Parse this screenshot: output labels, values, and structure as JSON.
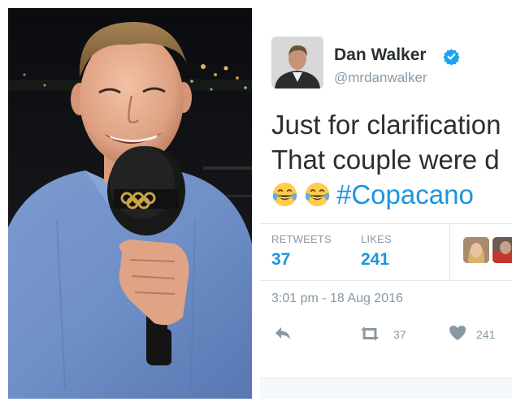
{
  "tweet": {
    "display_name": "Dan Walker",
    "username": "@mrdanwalker",
    "text_line1": "Just for clarification",
    "text_line2": "That couple were d",
    "hashtag": "#Copacano",
    "stats": {
      "retweets_label": "RETWEETS",
      "retweets_value": "37",
      "likes_label": "LIKES",
      "likes_value": "241"
    },
    "timestamp": "3:01 pm - 18 Aug 2016",
    "actions": {
      "retweet_count": "37",
      "like_count": "241"
    }
  },
  "icons": {
    "verified": "verified-badge-icon",
    "emoji": "face-with-tears-of-joy-icon",
    "reply": "reply-icon",
    "retweet": "retweet-icon",
    "like": "heart-icon"
  },
  "colors": {
    "link_blue": "#1b95e0",
    "text_dark": "#292f33",
    "text_muted": "#8899a6",
    "border": "#e1e8ed",
    "verified_blue": "#1da1f2"
  }
}
